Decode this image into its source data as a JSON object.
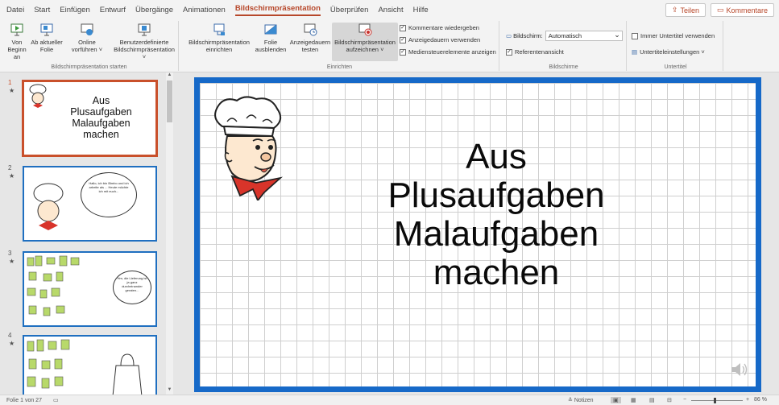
{
  "menu": {
    "tabs": [
      "Datei",
      "Start",
      "Einfügen",
      "Entwurf",
      "Übergänge",
      "Animationen",
      "Bildschirmpräsentation",
      "Überprüfen",
      "Ansicht",
      "Hilfe"
    ],
    "active_tab": "Bildschirmpräsentation",
    "share_label": "Teilen",
    "comments_label": "Kommentare"
  },
  "ribbon": {
    "start": {
      "from_beginning": "Von\nBeginn an",
      "from_current": "Ab aktueller\nFolie",
      "online": "Online\nvorführen ˅",
      "custom": "Benutzerdefinierte\nBildschirmpräsentation ˅",
      "group_label": "Bildschirmpräsentation starten"
    },
    "setup": {
      "setup_show": "Bildschirmpräsentation\neinrichten",
      "hide_slide": "Folie\nausblenden",
      "rehearse": "Anzeigedauern\ntesten",
      "record": "Bildschirmpräsentation\naufzeichnen ˅",
      "play_narrations": "Kommentare wiedergeben",
      "use_timings": "Anzeigedauern verwenden",
      "show_media": "Mediensteuerelemente anzeigen",
      "group_label": "Einrichten"
    },
    "monitors": {
      "monitor_label": "Bildschirm:",
      "monitor_value": "Automatisch",
      "presenter_view": "Referentenansicht",
      "group_label": "Bildschirme"
    },
    "captions": {
      "always_subtitles": "Immer Untertitel verwenden",
      "subtitle_settings": "Untertiteleinstellungen ˅",
      "group_label": "Untertitel"
    }
  },
  "thumbnails": [
    {
      "num": "1",
      "star": "★",
      "title": "Aus\nPlusaufgaben\nMalaufgaben\nmachen"
    },
    {
      "num": "2",
      "star": "★",
      "bubble": "Hallo, ich bin Bimbo und ich arbeite als ... Heute möchte ich mit euch..."
    },
    {
      "num": "3",
      "star": "★",
      "bubble": "Hm, die Lieferung ist ja ganz durcheinander geraten..."
    },
    {
      "num": "4",
      "star": "★"
    }
  ],
  "slide": {
    "title": "Aus\nPlusaufgaben\nMalaufgaben\nmachen"
  },
  "status": {
    "slide_counter": "Folie 1 von 27",
    "notes_label": "Notizen",
    "zoom": "86 %"
  },
  "colors": {
    "accent": "#b7472a",
    "slide_border": "#1669c8",
    "thumb_border": "#1f6fc0"
  }
}
